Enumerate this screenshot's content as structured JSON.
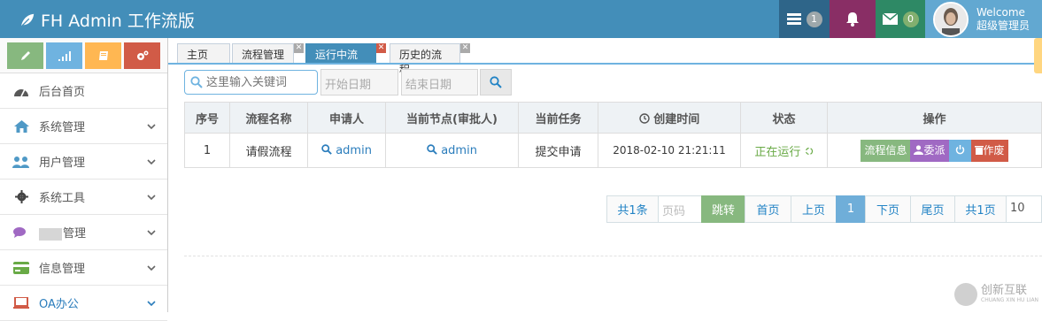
{
  "navbar": {
    "brand": "FH Admin 工作流版",
    "tasks_count": "1",
    "mail_count": "0",
    "welcome": "Welcome",
    "username": "超级管理员",
    "icons": [
      "leaf-icon",
      "tasks-icon",
      "bell-icon",
      "envelope-icon",
      "avatar"
    ]
  },
  "shortcuts": [
    "pencil-icon",
    "signal-icon",
    "book-icon",
    "cogs-icon"
  ],
  "sidebar": {
    "items": [
      {
        "label": "后台首页",
        "icon": "dashboard-icon"
      },
      {
        "label": "系统管理",
        "icon": "home-icon"
      },
      {
        "label": "用户管理",
        "icon": "users-icon"
      },
      {
        "label": "系统工具",
        "icon": "cog-icon"
      },
      {
        "label": "管理",
        "icon": "comments-icon"
      },
      {
        "label": "信息管理",
        "icon": "credit-card-icon"
      },
      {
        "label": "OA办公",
        "icon": "laptop-icon"
      }
    ]
  },
  "tabs": [
    {
      "label": "主页"
    },
    {
      "label": "流程管理"
    },
    {
      "label": "运行中流程"
    },
    {
      "label": "历史的流程"
    }
  ],
  "search": {
    "placeholder": "这里输入关键词",
    "start_date": "开始日期",
    "end_date": "结束日期"
  },
  "table": {
    "headers": [
      "序号",
      "流程名称",
      "申请人",
      "当前节点(审批人)",
      "当前任务",
      "创建时间",
      "状态",
      "操作"
    ],
    "rows": [
      {
        "index": "1",
        "name": "请假流程",
        "applicant": "admin",
        "node": "admin",
        "task": "提交申请",
        "created": "2018-02-10 21:21:11",
        "status": "正在运行",
        "actions": [
          "流程信息",
          "委派",
          "作废"
        ]
      }
    ]
  },
  "pager": {
    "total": "共1条",
    "page_input": "页码",
    "jump": "跳转",
    "first": "首页",
    "prev": "上页",
    "current": "1",
    "next": "下页",
    "last": "尾页",
    "pages": "共1页",
    "page_size": "10"
  },
  "watermark": {
    "name": "创新互联",
    "sub": "CHUANG XIN HU LIAN"
  },
  "colors": {
    "navbar": "#438eb9",
    "accent_green": "#87b87f",
    "accent_blue": "#6fb3e0",
    "accent_orange": "#ffb752",
    "accent_red": "#d15b47",
    "accent_purple": "#a069c3"
  }
}
